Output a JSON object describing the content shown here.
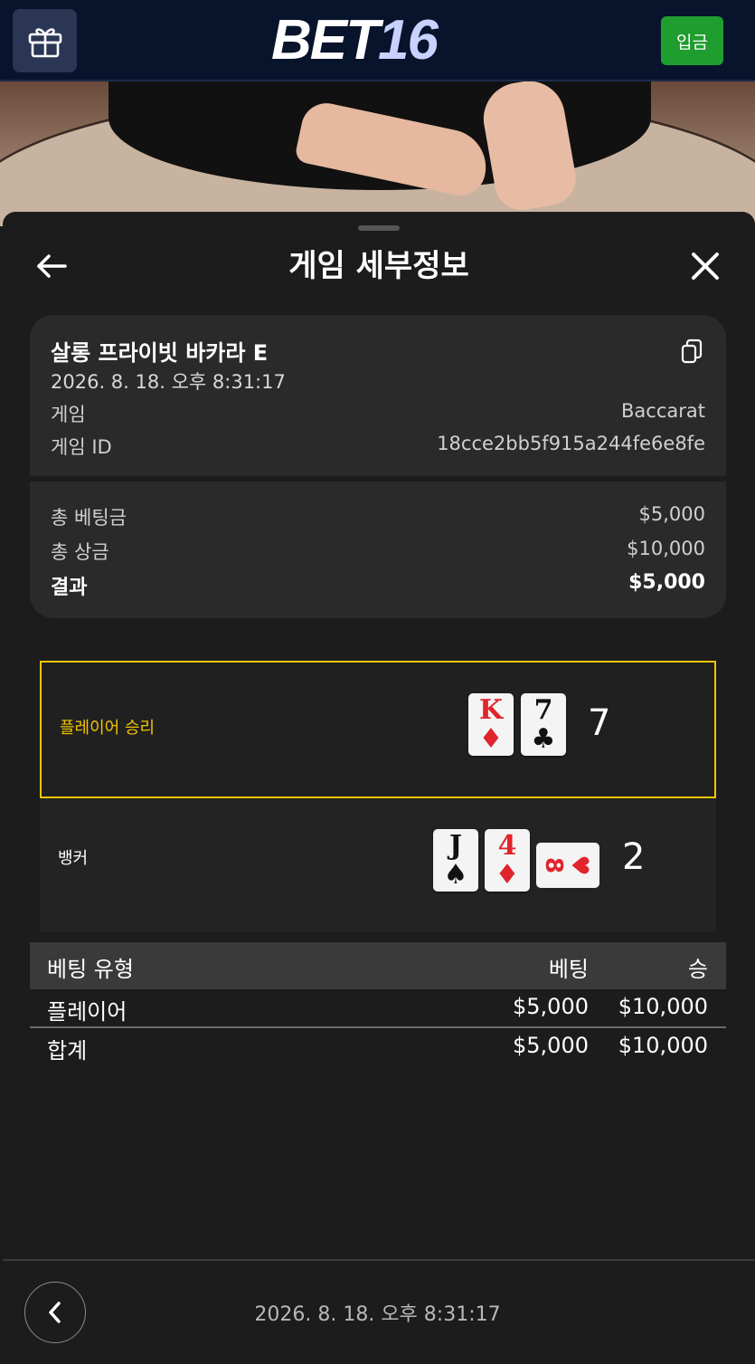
{
  "header": {
    "logo_part1": "BET",
    "logo_part2": "16",
    "deposit_label": "입금",
    "brand_color": "#07142c",
    "deposit_color": "#1f9d2f"
  },
  "sheet": {
    "title": "게임 세부정보"
  },
  "game_info": {
    "table_name": "살롱 프라이빗 바카라 E",
    "datetime": "2026. 8. 18. 오후 8:31:17",
    "game_label": "게임",
    "game_value": "Baccarat",
    "game_id_label": "게임 ID",
    "game_id_value": "18cce2bb5f915a244fe6e8fe"
  },
  "totals": {
    "total_bet_label": "총 베팅금",
    "total_bet_value": "$5,000",
    "total_win_label": "총 상금",
    "total_win_value": "$10,000",
    "result_label": "결과",
    "result_value": "$5,000"
  },
  "result": {
    "player_label": "플레이어 승리",
    "player_score": "7",
    "player_cards": [
      {
        "rank": "K",
        "suit": "♦",
        "color": "red"
      },
      {
        "rank": "7",
        "suit": "♣",
        "color": "black"
      }
    ],
    "banker_label": "뱅커",
    "banker_score": "2",
    "banker_cards": [
      {
        "rank": "J",
        "suit": "♠",
        "color": "black"
      },
      {
        "rank": "4",
        "suit": "♦",
        "color": "red"
      }
    ],
    "banker_third_card": {
      "rank": "8",
      "suit": "♥",
      "color": "red"
    },
    "winner_color": "#f2c500"
  },
  "bet_table": {
    "headers": [
      "베팅 유형",
      "베팅",
      "승"
    ],
    "rows": [
      [
        "플레이어",
        "$5,000",
        "$10,000"
      ]
    ],
    "total": [
      "합계",
      "$5,000",
      "$10,000"
    ]
  },
  "footer": {
    "datetime": "2026. 8. 18. 오후 8:31:17"
  }
}
